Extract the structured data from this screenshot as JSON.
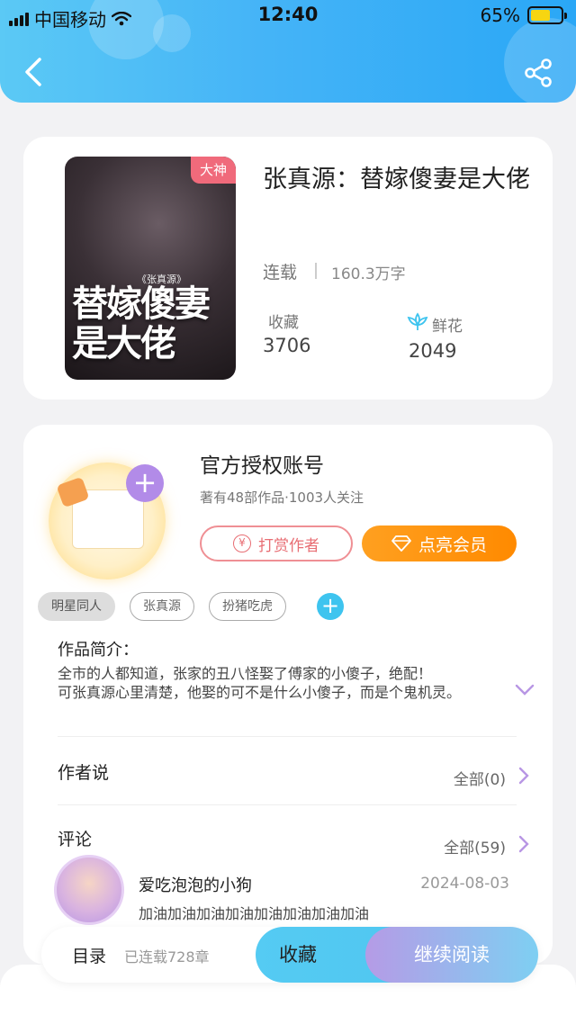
{
  "status_bar": {
    "carrier": "中国移动",
    "time": "12:40",
    "battery": "65%",
    "battery_level": 0.65
  },
  "book": {
    "badge": "大神",
    "cover_title": "替嫁傻妻是大佬",
    "cover_author": "《张真源》",
    "title": "张真源：替嫁傻妻是大佬",
    "status": "连载",
    "word_count": "160.3万字",
    "favorites_label": "收藏",
    "favorites_value": "3706",
    "flowers_label": "鲜花",
    "flowers_value": "2049"
  },
  "author": {
    "name": "官方授权账号",
    "meta": "著有48部作品·1003人关注",
    "tip_label": "打赏作者",
    "tip_icon_glyph": "¥",
    "vip_label": "点亮会员"
  },
  "tags": [
    "明星同人",
    "张真源",
    "扮猪吃虎"
  ],
  "intro": {
    "label": "作品简介：",
    "line1": "全市的人都知道，张家的丑八怪娶了傅家的小傻子，绝配！",
    "line2": "可张真源心里清楚，他娶的可不是什么小傻子，而是个鬼机灵。"
  },
  "author_says": {
    "title": "作者说",
    "more": "全部(0)"
  },
  "comments": {
    "title": "评论",
    "more": "全部(59)",
    "items": [
      {
        "user": "爱吃泡泡的小狗",
        "date": "2024-08-03",
        "text": "加油加油加油加油加油加油加油加油"
      }
    ]
  },
  "bottom_bar": {
    "toc_label": "目录",
    "toc_count": "已连载728章",
    "favorite_label": "收藏",
    "read_label": "继续阅读"
  },
  "colors": {
    "header_start": "#5bc9f5",
    "header_end": "#2aa7f6",
    "badge": "#f06a7b",
    "vip": "#ff8a00",
    "accent_purple": "#b28be8",
    "accent_cyan": "#3ec4ef"
  }
}
